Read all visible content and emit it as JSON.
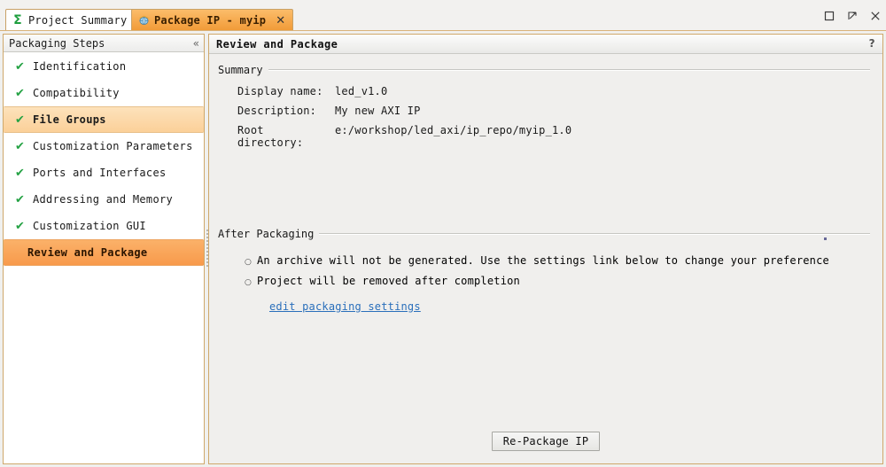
{
  "window": {
    "controls": [
      {
        "name": "maximize",
        "glyph": "▫"
      },
      {
        "name": "float",
        "glyph": "⇱"
      },
      {
        "name": "close",
        "glyph": "✕"
      }
    ]
  },
  "tabs": [
    {
      "label": "Project Summary",
      "icon": "sigma-icon",
      "icon_glyph": "Σ",
      "close_glyph": "✕",
      "active": false
    },
    {
      "label": "Package IP - myip",
      "icon": "package-icon",
      "icon_glyph": "",
      "close_glyph": "✕",
      "active": true
    }
  ],
  "sidebar": {
    "title": "Packaging Steps",
    "collapse_glyph": "«",
    "check_glyph": "✔",
    "items": [
      {
        "label": "Identification",
        "done": true,
        "state": "normal"
      },
      {
        "label": "Compatibility",
        "done": true,
        "state": "normal"
      },
      {
        "label": "File Groups",
        "done": true,
        "state": "hover"
      },
      {
        "label": "Customization Parameters",
        "done": true,
        "state": "normal"
      },
      {
        "label": "Ports and Interfaces",
        "done": true,
        "state": "normal"
      },
      {
        "label": "Addressing and Memory",
        "done": true,
        "state": "normal"
      },
      {
        "label": "Customization GUI",
        "done": true,
        "state": "normal"
      },
      {
        "label": "Review and Package",
        "done": false,
        "state": "selected"
      }
    ]
  },
  "content": {
    "title": "Review and Package",
    "help_glyph": "?",
    "summary": {
      "heading": "Summary",
      "fields": [
        {
          "label": "Display name:",
          "value": "led_v1.0"
        },
        {
          "label": "Description:",
          "value": "My new AXI IP"
        },
        {
          "label": "Root directory:",
          "value": "e:/workshop/led_axi/ip_repo/myip_1.0"
        }
      ]
    },
    "after_packaging": {
      "heading": "After Packaging",
      "bullet_glyph": "○",
      "bullets": [
        "An archive will not be generated. Use the settings link below to change your preference",
        "Project will be removed after completion"
      ],
      "settings_link": "edit packaging settings"
    },
    "repackage_button": "Re-Package IP"
  },
  "colors": {
    "accent_orange": "#f89a4b",
    "hover_orange": "#fbd099",
    "frame_tan": "#cfa86b",
    "check_green": "#25a244",
    "link_blue": "#2a6fbb"
  }
}
